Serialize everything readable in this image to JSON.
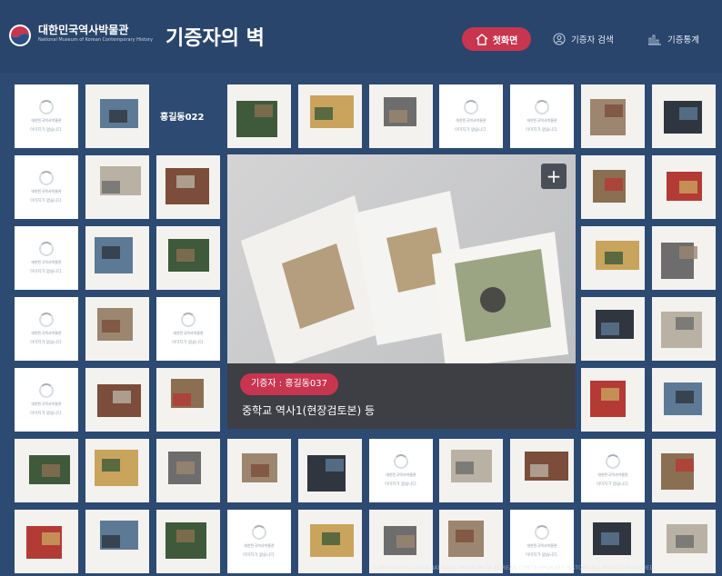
{
  "header": {
    "org_name_ko": "대한민국역사박물관",
    "org_name_en": "National Museum of Korean Contemporary History",
    "page_title": "기증자의 벽",
    "home_label": "첫화면",
    "search_label": "기증자 검색",
    "stats_label": "기증통계"
  },
  "placeholder": {
    "org": "대한민국역사박물관",
    "message": "이미지가 없습니다."
  },
  "hover_label": "홍길동022",
  "feature": {
    "donor_badge": "기증자 : 홍길동037",
    "title": "중학교 역사1(현장검토본) 등",
    "expand_icon": "plus-icon"
  },
  "copyright": "COPYRIGHT(C) 2019 NATIONAL MUSEUM OF KOREAN CONTEMPORARY HISTORY ALL RIGHTS RESERVED.",
  "colors": {
    "background": "#2d4a72",
    "accent": "#c8354f",
    "caption_bg": "#3d3f44"
  }
}
